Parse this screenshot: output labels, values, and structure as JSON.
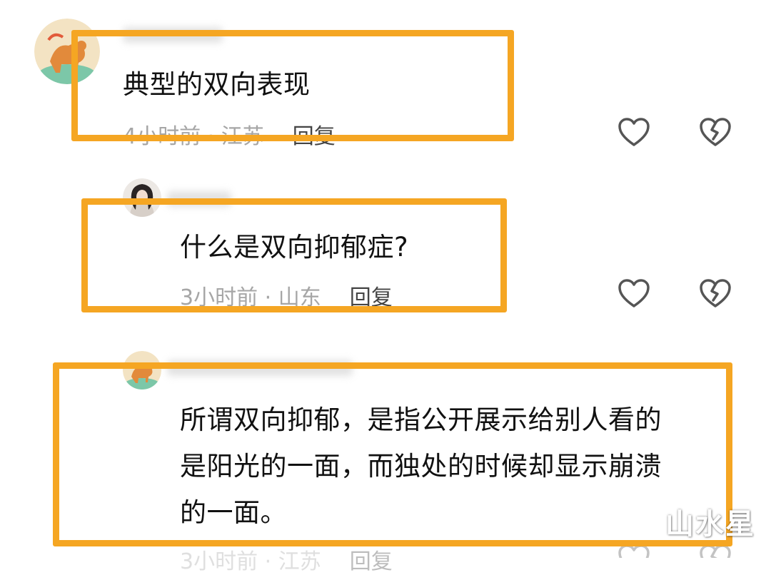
{
  "comments": [
    {
      "text": "典型的双向表现",
      "time": "4小时前",
      "location": "江苏",
      "reply_label": "回复"
    },
    {
      "text": "什么是双向抑郁症?",
      "time": "3小时前",
      "location": "山东",
      "reply_label": "回复"
    },
    {
      "text_lines": [
        "所谓双向抑郁，是指公开展示给别人看的",
        "是阳光的一面，而独处的时候却显示崩溃",
        "的一面。"
      ],
      "time": "3小时前",
      "location": "江苏",
      "reply_label": "回复"
    }
  ],
  "separator": " · ",
  "icons": {
    "like": "heart-outline-icon",
    "dislike": "broken-heart-icon"
  },
  "colors": {
    "highlight": "#f5a623",
    "meta_text": "#a6a6a6",
    "icon_stroke": "#555555"
  },
  "watermark": "山水星"
}
